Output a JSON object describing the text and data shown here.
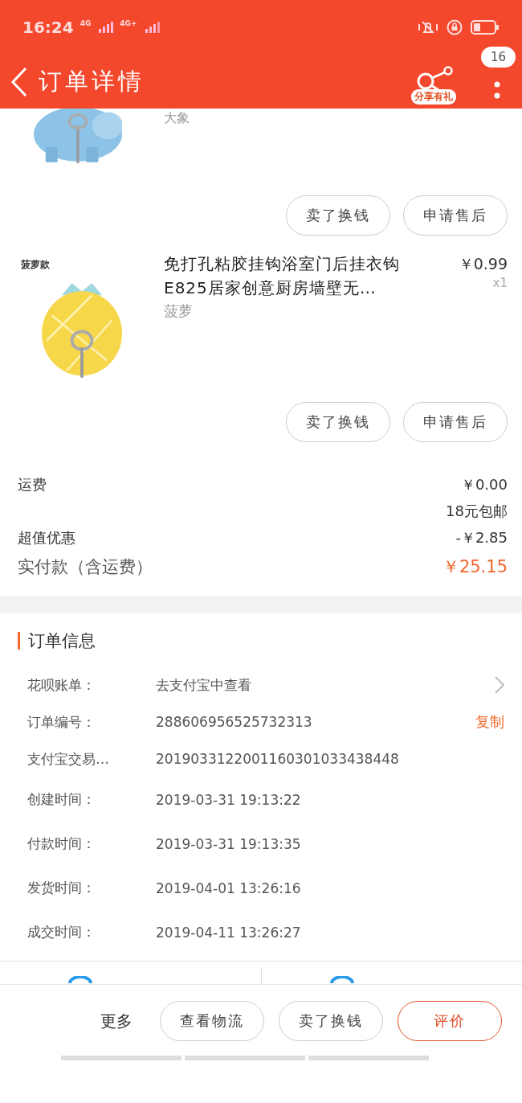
{
  "status_bar": {
    "time": "16:24",
    "signal_1": "4G",
    "signal_2": "4G+"
  },
  "header": {
    "title": "订单详情",
    "share_label": "分享有礼",
    "badge": "16"
  },
  "products": [
    {
      "kind": "picture",
      "variant": "大象",
      "partial": true,
      "buttons": [
        "卖了换钱",
        "申请售后"
      ]
    },
    {
      "kind": "picture",
      "caption": "菠萝款",
      "title": "免打孔粘胶挂钩浴室门后挂衣钩E825居家创意厨房墙壁无…",
      "price": "￥0.99",
      "quantity": "x1",
      "variant": "菠萝",
      "partial": false,
      "buttons": [
        "卖了换钱",
        "申请售后"
      ]
    }
  ],
  "fees": [
    {
      "label": "运费",
      "value": "￥0.00",
      "note": "18元包邮",
      "kind": "normal"
    },
    {
      "label": "超值优惠",
      "value": "-￥2.85",
      "kind": "normal"
    },
    {
      "label": "实付款（含运费）",
      "value": "￥25.15",
      "kind": "total"
    }
  ],
  "order_info": {
    "title": "订单信息",
    "rows": [
      {
        "label": "花呗账单：",
        "value": "去支付宝中查看",
        "kind": "link"
      },
      {
        "label": "订单编号：",
        "value": "288606956525732313",
        "action": "复制",
        "kind": "copy"
      },
      {
        "label": "支付宝交易…",
        "value": "2019033122001160301033438448",
        "kind": "plain"
      },
      {
        "label": "创建时间：",
        "value": "2019-03-31 19:13:22",
        "kind": "plain"
      },
      {
        "label": "付款时间：",
        "value": "2019-03-31 19:13:35",
        "kind": "plain"
      },
      {
        "label": "发货时间：",
        "value": "2019-04-01 13:26:16",
        "kind": "plain"
      },
      {
        "label": "成交时间：",
        "value": "2019-04-11 13:26:27",
        "kind": "plain"
      }
    ]
  },
  "bottom_bar": {
    "more": "更多",
    "buttons": [
      {
        "label": "查看物流",
        "primary": false
      },
      {
        "label": "卖了换钱",
        "primary": false
      },
      {
        "label": "评价",
        "primary": true
      }
    ]
  }
}
